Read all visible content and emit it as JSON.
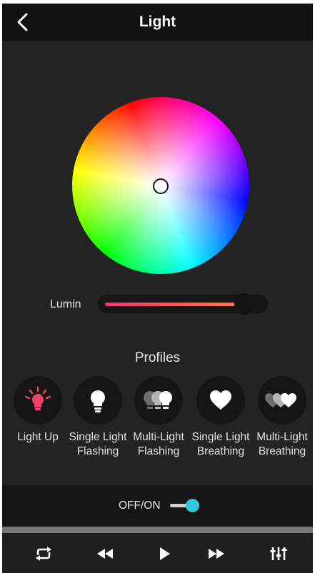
{
  "header": {
    "title": "Light",
    "back_icon": "chevron-left-icon"
  },
  "color_picker": {
    "selected_color": "#ffffff"
  },
  "luminance": {
    "label": "Lumin",
    "value_fraction": 0.92,
    "fill_start_color": "#e63e73",
    "fill_end_color": "#f07f4f"
  },
  "profiles": {
    "title": "Profiles",
    "items": [
      {
        "label": "Light Up",
        "icon": "bulb-glow-icon",
        "active": true
      },
      {
        "label": "Single Light Flashing",
        "icon": "bulb-icon",
        "active": false
      },
      {
        "label": "Multi-Light Flashing",
        "icon": "multi-bulb-icon",
        "active": false
      },
      {
        "label": "Single Light Breathing",
        "icon": "heart-icon",
        "active": false
      },
      {
        "label": "Multi-Light Breathing",
        "icon": "multi-heart-icon",
        "active": false
      }
    ]
  },
  "power": {
    "label": "OFF/ON",
    "on": true,
    "accent_color": "#35c6d8"
  },
  "player": {
    "buttons": [
      "repeat-icon",
      "rewind-icon",
      "play-icon",
      "fast-forward-icon",
      "equalizer-icon"
    ]
  },
  "colors": {
    "active_profile": "#f0436a",
    "inactive_profile": "#ffffff"
  }
}
